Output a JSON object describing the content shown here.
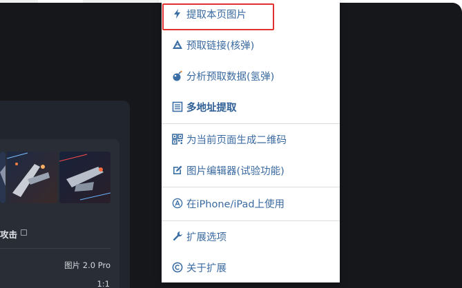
{
  "background_app": {
    "title_fragment": "攻击",
    "model_label": "图片 2.0 Pro",
    "ratio_label": "1:1"
  },
  "menu": {
    "items": [
      {
        "label": "提取本页图片",
        "icon": "lightning-icon"
      },
      {
        "label": "预取链接(核弹)",
        "icon": "radiation-icon"
      },
      {
        "label": "分析预取数据(氢弹)",
        "icon": "bomb-icon"
      },
      {
        "label": "多地址提取",
        "icon": "list-icon"
      },
      {
        "label": "为当前页面生成二维码",
        "icon": "qrcode-icon"
      },
      {
        "label": "图片编辑器(试验功能)",
        "icon": "edit-icon"
      },
      {
        "label": "在iPhone/iPad上使用",
        "icon": "appstore-icon"
      },
      {
        "label": "扩展选项",
        "icon": "wrench-icon"
      },
      {
        "label": "关于扩展",
        "icon": "copyright-icon"
      }
    ]
  },
  "colors": {
    "menu_text": "#3a6aa0",
    "highlight_border": "#e03030",
    "app_background": "#15171b"
  }
}
